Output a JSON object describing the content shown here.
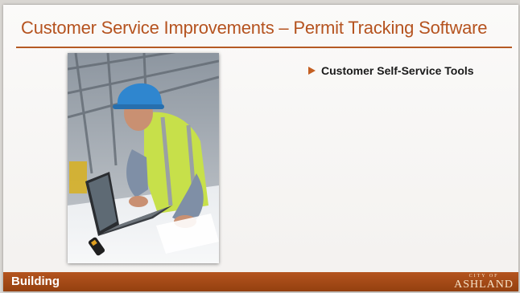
{
  "slide": {
    "title": "Customer Service Improvements – Permit Tracking Software",
    "bullets": [
      {
        "text": "Customer Self-Service Tools"
      }
    ],
    "footer": {
      "section": "Building",
      "logo_small": "CITY OF",
      "logo_main": "ASHLAND"
    },
    "photo": {
      "subject": "construction worker in hard hat and safety vest using a laptop"
    },
    "colors": {
      "accent": "#b5531f",
      "footer_bar": "#a24a18",
      "bullet_marker": "#c45f22"
    }
  }
}
